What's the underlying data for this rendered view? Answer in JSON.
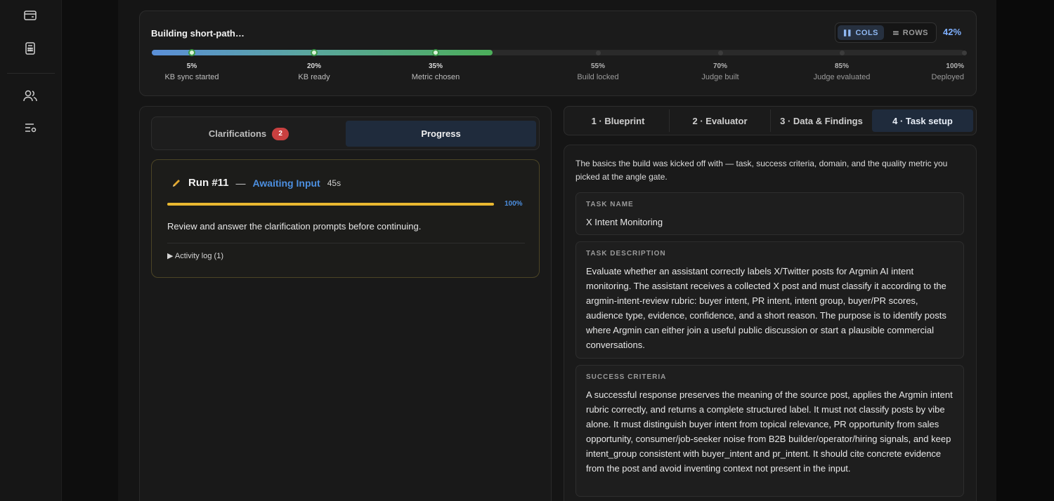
{
  "nav": {
    "items": [
      {
        "name": "card-icon"
      },
      {
        "name": "calculator-icon"
      },
      {
        "name": "users-icon"
      },
      {
        "name": "list-settings-icon"
      }
    ]
  },
  "build": {
    "title": "Building short-path…",
    "view_toggle": {
      "cols_label": "COLS",
      "rows_label": "ROWS",
      "selected": "COLS"
    },
    "percent_label": "42%",
    "progress": 0.42,
    "milestones": [
      {
        "pct": "5%",
        "label": "KB sync started",
        "done": true
      },
      {
        "pct": "20%",
        "label": "KB ready",
        "done": true
      },
      {
        "pct": "35%",
        "label": "Metric chosen",
        "done": true
      },
      {
        "pct": "55%",
        "label": "Build locked",
        "done": false
      },
      {
        "pct": "70%",
        "label": "Judge built",
        "done": false
      },
      {
        "pct": "85%",
        "label": "Judge evaluated",
        "done": false
      },
      {
        "pct": "100%",
        "label": "Deployed",
        "done": false
      }
    ]
  },
  "left_tabs": {
    "clarifications": "Clarifications",
    "clarifications_count": "2",
    "progress": "Progress",
    "active": "Progress"
  },
  "run": {
    "title": "Run #11",
    "dash": "—",
    "status": "Awaiting Input",
    "elapsed": "45s",
    "progress": 1.0,
    "progress_label": "100%",
    "message": "Review and answer the clarification prompts before continuing.",
    "activity_log": "▶ Activity log (1)"
  },
  "right_tabs": {
    "items": [
      "1 · Blueprint",
      "2 · Evaluator",
      "3 · Data & Findings",
      "4 · Task setup"
    ],
    "active": "4 · Task setup"
  },
  "task_setup": {
    "intro": "The basics the build was kicked off with — task, success criteria, domain, and the quality metric you picked at the angle gate.",
    "task_name_label": "TASK NAME",
    "task_name": "X Intent Monitoring",
    "task_description_label": "TASK DESCRIPTION",
    "task_description": "Evaluate whether an assistant correctly labels X/Twitter posts for Argmin AI intent monitoring. The assistant receives a collected X post and must classify it according to the argmin-intent-review rubric: buyer intent, PR intent, intent group, buyer/PR scores, audience type, evidence, confidence, and a short reason. The purpose is to identify posts where Argmin can either join a useful public discussion or start a plausible commercial conversations.",
    "success_criteria_label": "SUCCESS CRITERIA",
    "success_criteria": "A successful response preserves the meaning of the source post, applies the Argmin intent rubric correctly, and returns a complete structured label. It must not classify posts by vibe alone. It must distinguish buyer intent from topical relevance, PR opportunity from sales opportunity, consumer/job-seeker noise from B2B builder/operator/hiring signals, and keep intent_group consistent with buyer_intent and pr_intent. It should cite concrete evidence from the post and avoid inventing context not present in the input."
  }
}
